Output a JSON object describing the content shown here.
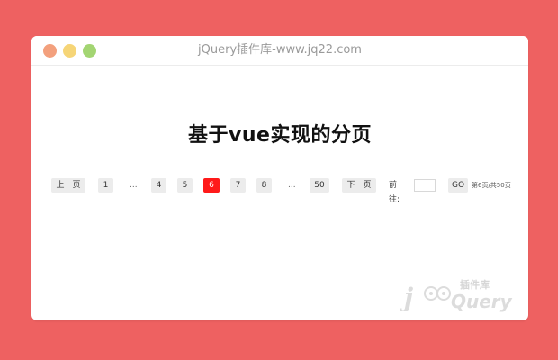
{
  "window": {
    "title": "jQuery插件库-www.jq22.com"
  },
  "page": {
    "heading": "基于vue实现的分页"
  },
  "pagination": {
    "prev_label": "上一页",
    "next_label": "下一页",
    "first_page": "1",
    "ellipsis_left": "...",
    "page_4": "4",
    "page_5": "5",
    "current_page": "6",
    "page_7": "7",
    "page_8": "8",
    "ellipsis_right": "...",
    "last_page": "50",
    "goto_label": "前往:",
    "goto_value": "",
    "go_label": "GO",
    "summary": "第6页/共50页"
  },
  "watermark": {
    "brand_text": "jQuery",
    "brand_cn": "插件库"
  },
  "colors": {
    "background": "#ee6161",
    "active_page": "#ff1a1a",
    "dot_red": "#f3a07d",
    "dot_yellow": "#f6d577",
    "dot_green": "#a3d572"
  }
}
